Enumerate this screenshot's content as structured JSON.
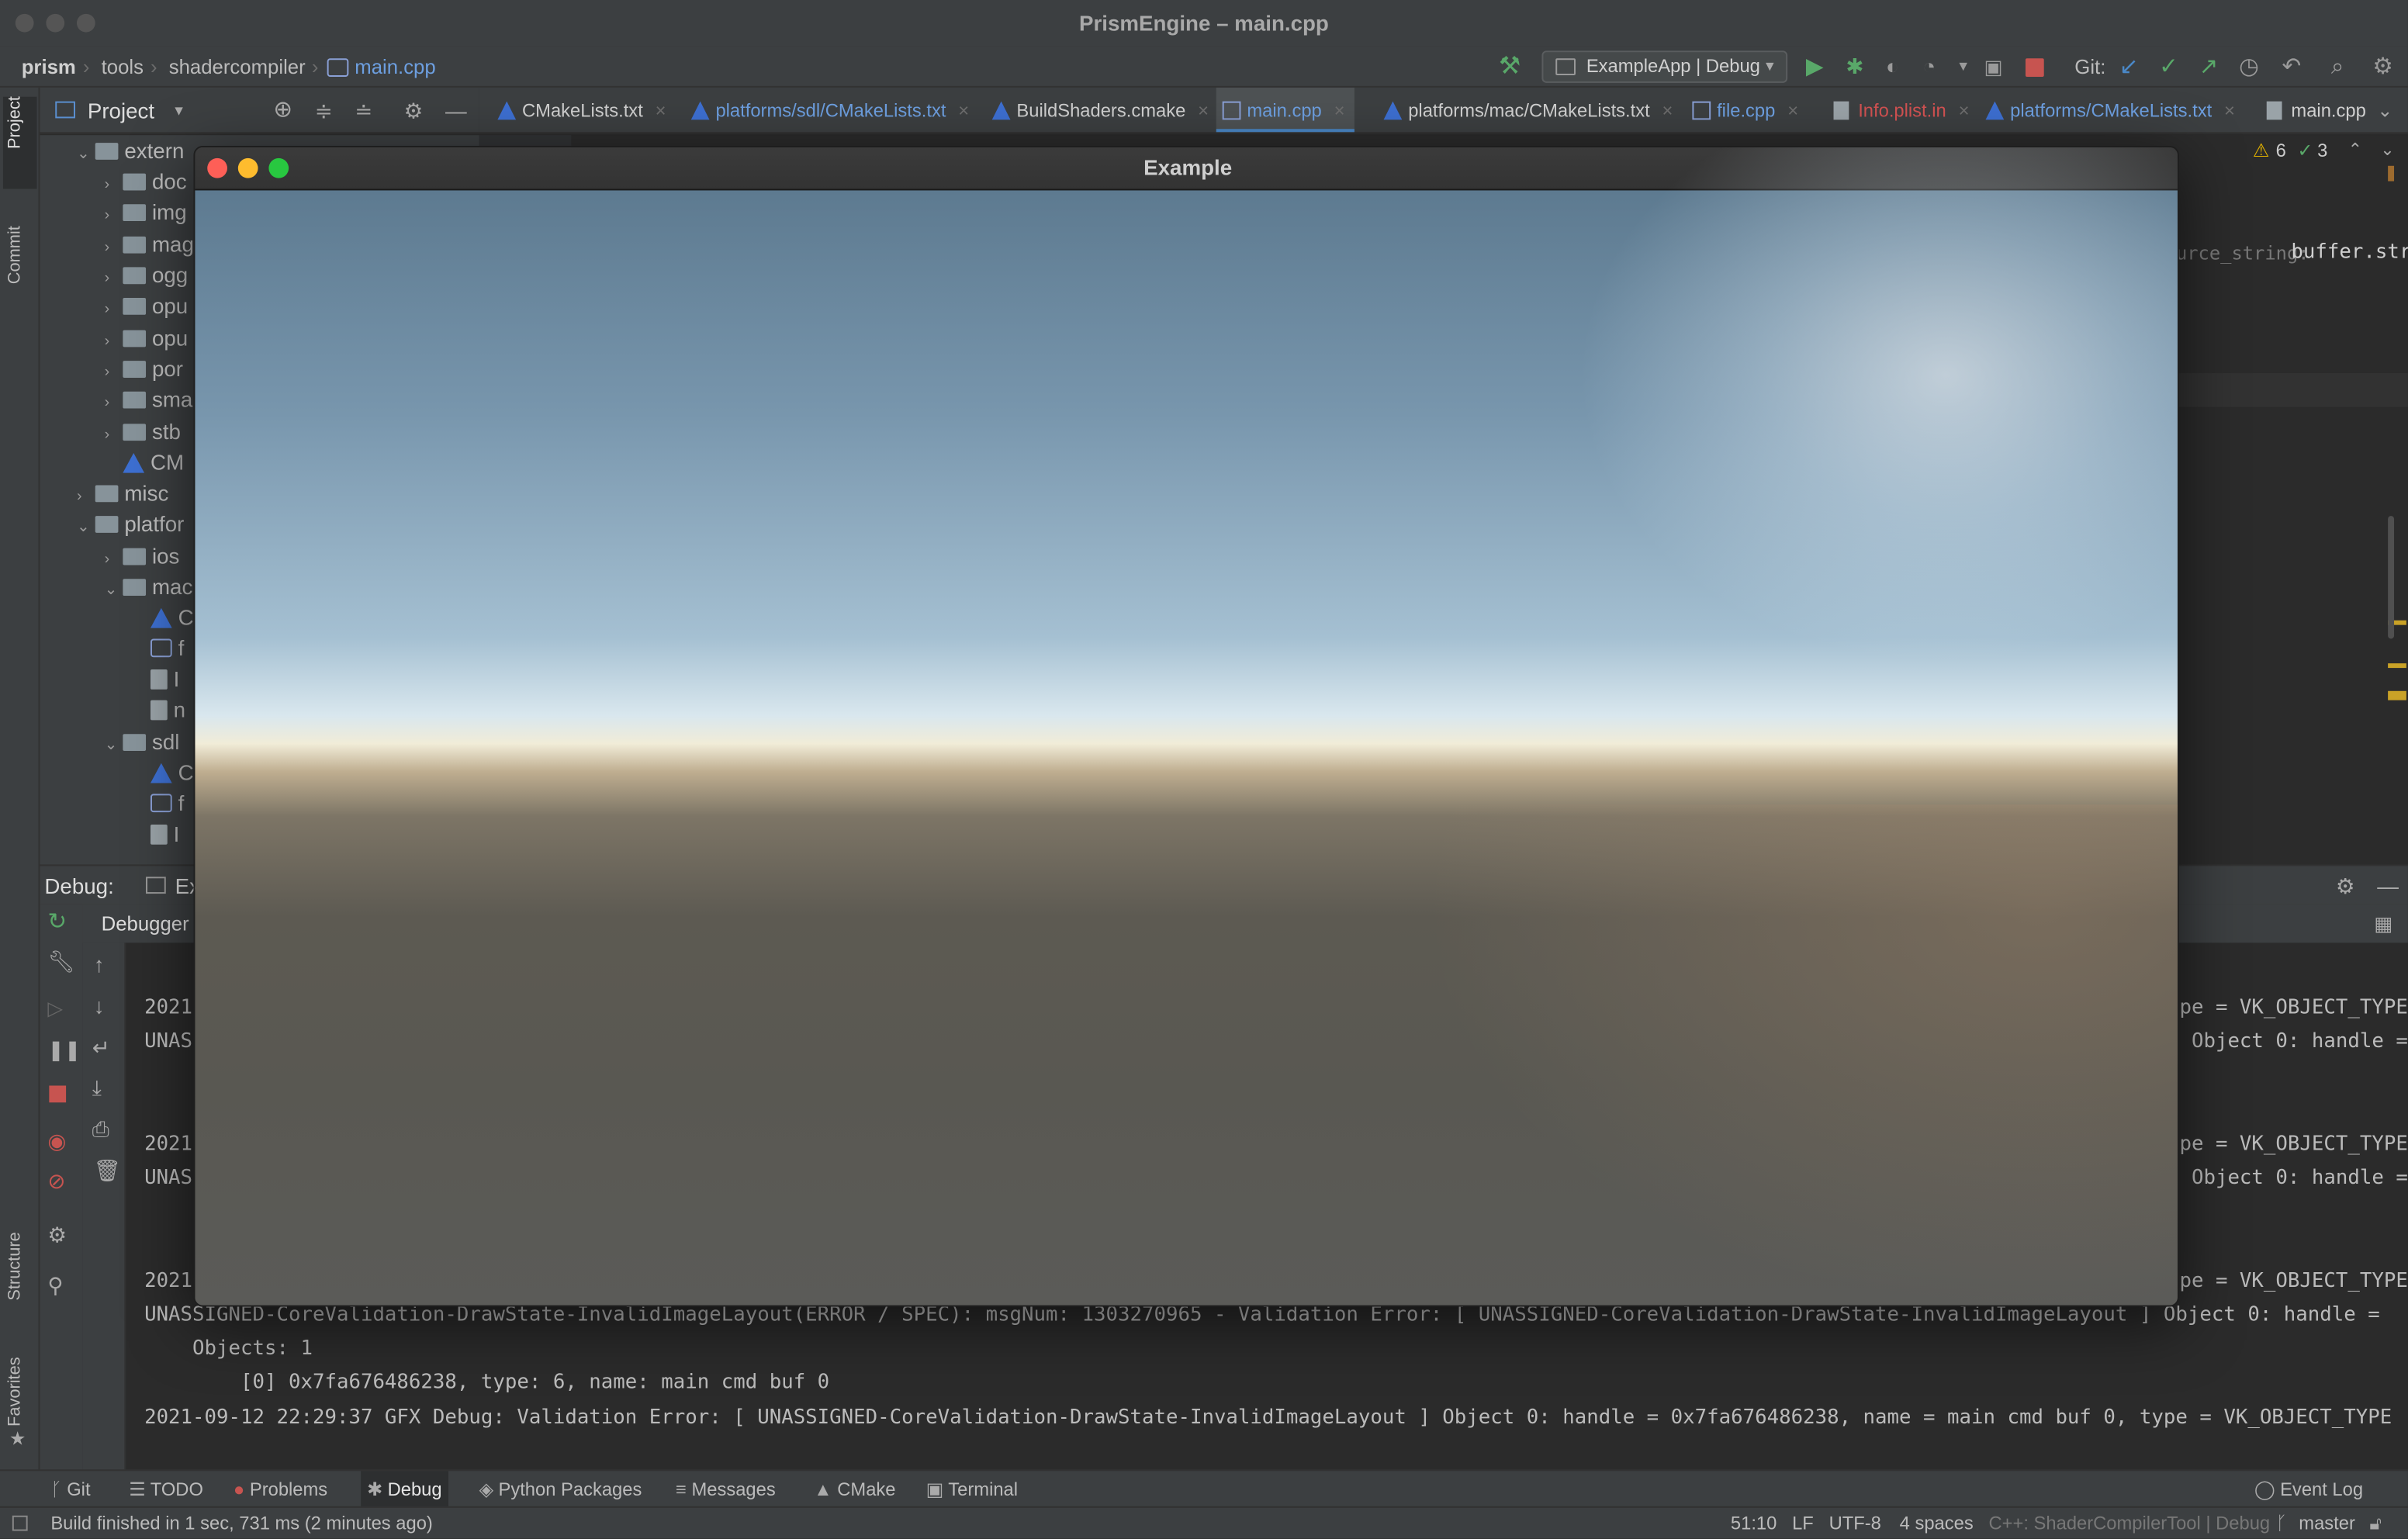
{
  "window": {
    "title": "PrismEngine – main.cpp"
  },
  "nav": {
    "crumbs": [
      "prism",
      "tools",
      "shadercompiler",
      "main.cpp"
    ],
    "run_config": "ExampleApp | Debug",
    "git_label": "Git:"
  },
  "project_panel": {
    "title": "Project",
    "tree": [
      {
        "label": "extern",
        "depth": 1,
        "expanded": true,
        "kind": "folder"
      },
      {
        "label": "doc",
        "depth": 2,
        "kind": "folder"
      },
      {
        "label": "img",
        "depth": 2,
        "kind": "folder"
      },
      {
        "label": "mag",
        "depth": 2,
        "kind": "folder"
      },
      {
        "label": "ogg",
        "depth": 2,
        "kind": "folder"
      },
      {
        "label": "opu",
        "depth": 2,
        "kind": "folder"
      },
      {
        "label": "opu",
        "depth": 2,
        "kind": "folder"
      },
      {
        "label": "por",
        "depth": 2,
        "kind": "folder"
      },
      {
        "label": "sma",
        "depth": 2,
        "kind": "folder"
      },
      {
        "label": "stb",
        "depth": 2,
        "kind": "folder"
      },
      {
        "label": "CM",
        "depth": 2,
        "kind": "cmake"
      },
      {
        "label": "misc",
        "depth": 1,
        "kind": "folder"
      },
      {
        "label": "platfor",
        "depth": 1,
        "expanded": true,
        "kind": "folder"
      },
      {
        "label": "ios",
        "depth": 2,
        "kind": "folder"
      },
      {
        "label": "mac",
        "depth": 2,
        "expanded": true,
        "kind": "folder"
      },
      {
        "label": "C",
        "depth": 3,
        "kind": "cmake"
      },
      {
        "label": "f",
        "depth": 3,
        "kind": "cpp"
      },
      {
        "label": "I",
        "depth": 3,
        "kind": "file"
      },
      {
        "label": "n",
        "depth": 3,
        "kind": "file"
      },
      {
        "label": "sdl",
        "depth": 2,
        "expanded": true,
        "kind": "folder"
      },
      {
        "label": "C",
        "depth": 3,
        "kind": "cmake"
      },
      {
        "label": "f",
        "depth": 3,
        "kind": "cpp"
      },
      {
        "label": "I",
        "depth": 3,
        "kind": "file"
      }
    ]
  },
  "tabs": [
    {
      "label": "CMakeLists.txt",
      "kind": "cmake"
    },
    {
      "label": "platforms/sdl/CMakeLists.txt",
      "kind": "cmake"
    },
    {
      "label": "BuildShaders.cmake",
      "kind": "cmake"
    },
    {
      "label": "main.cpp",
      "kind": "cpp",
      "active": true
    },
    {
      "label": "platforms/mac/CMakeLists.txt",
      "kind": "cmake"
    },
    {
      "label": "file.cpp",
      "kind": "cpp"
    },
    {
      "label": "Info.plist.in",
      "kind": "plist"
    },
    {
      "label": "platforms/CMakeLists.txt",
      "kind": "cmake"
    },
    {
      "label": "main.cpp",
      "kind": "file"
    }
  ],
  "editor": {
    "warnings": "6",
    "checks": "3",
    "code_hint": "urce_string:",
    "code_text": "buffer.str"
  },
  "debug": {
    "label": "Debug:",
    "session": "Ex",
    "debugger_tab": "Debugger",
    "console_lines": [
      {
        "left": "2021",
        "right": "pe = VK_OBJECT_TYPE"
      },
      {
        "left": "UNAS",
        "right": "Object 0: handle ="
      },
      {
        "left": "2021",
        "right": "pe = VK_OBJECT_TYPE"
      },
      {
        "left": "UNAS",
        "right": "Object 0: handle ="
      },
      {
        "left": "2021",
        "right": "pe = VK_OBJECT_TYPE"
      }
    ],
    "full_lines": [
      "UNASSIGNED-CoreValidation-DrawState-InvalidImageLayout(ERROR / SPEC): msgNum: 1303270965 - Validation Error: [ UNASSIGNED-CoreValidation-DrawState-InvalidImageLayout ] Object 0: handle =",
      "    Objects: 1",
      "        [0] 0x7fa676486238, type: 6, name: main cmd buf 0",
      "2021-09-12 22:29:37 GFX Debug: Validation Error: [ UNASSIGNED-CoreValidation-DrawState-InvalidImageLayout ] Object 0: handle = 0x7fa676486238, name = main cmd buf 0, type = VK_OBJECT_TYPE"
    ]
  },
  "side_labels": {
    "project": "Project",
    "commit": "Commit",
    "structure": "Structure",
    "favorites": "Favorites"
  },
  "tool_windows": [
    "Git",
    "TODO",
    "Problems",
    "Debug",
    "Python Packages",
    "Messages",
    "CMake",
    "Terminal"
  ],
  "event_log": "Event Log",
  "status": {
    "message": "Build finished in 1 sec, 731 ms (2 minutes ago)",
    "position": "51:10",
    "line_sep": "LF",
    "encoding": "UTF-8",
    "indent": "4 spaces",
    "context": "C++: ShaderCompilerTool | Debug",
    "branch": "master"
  },
  "example_window": {
    "title": "Example"
  },
  "colors": {
    "accent": "#4a88c7",
    "error": "#c75450",
    "run": "#59a869",
    "cmake_red": "#d33",
    "cmake_blue": "#3d6fd1",
    "cmake_green": "#3c9f3c"
  }
}
